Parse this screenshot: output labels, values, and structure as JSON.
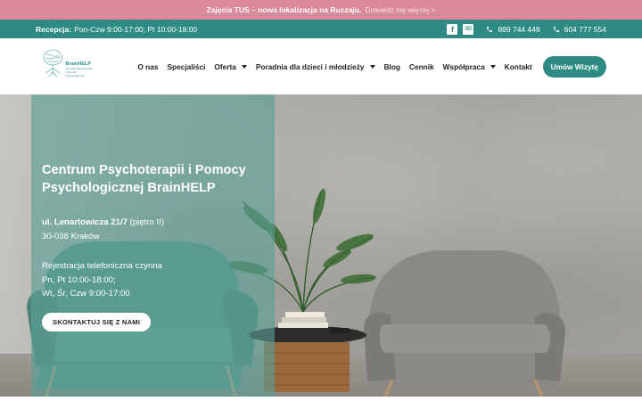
{
  "promo": {
    "text": "Zajęcia TUS – nowa lokalizacja na Ruczaju.",
    "link": "Dowiedz się więcej >"
  },
  "infobar": {
    "reception_label": "Recepcja:",
    "reception_hours": "Pon-Czw 9:00-17:00; Pt 10:00-18:00",
    "social": [
      {
        "icon": "facebook-icon",
        "glyph": "f"
      },
      {
        "icon": "email-icon",
        "glyph": "✉"
      }
    ],
    "phones": [
      "889 744 448",
      "604 777 554"
    ]
  },
  "header": {
    "logo": {
      "name": "BrainHELP",
      "subtitle_1": "Centrum Psychoterapii",
      "subtitle_2": "i Pomocy Psychologicznej"
    },
    "nav": [
      {
        "label": "O nas",
        "dropdown": false
      },
      {
        "label": "Specjaliści",
        "dropdown": false
      },
      {
        "label": "Oferta",
        "dropdown": true
      },
      {
        "label": "Poradnia dla dzieci i młodzieży",
        "dropdown": true
      },
      {
        "label": "Blog",
        "dropdown": false
      },
      {
        "label": "Cennik",
        "dropdown": false
      },
      {
        "label": "Współpraca",
        "dropdown": true
      },
      {
        "label": "Kontakt",
        "dropdown": false
      }
    ],
    "cta": "Umów Wizytę"
  },
  "hero": {
    "title_line1": "Centrum Psychoterapii i Pomocy",
    "title_line2": "Psychologicznej BrainHELP",
    "address_street": "ul. Lenartowicza 21/7",
    "address_floor": "(piętro II)",
    "address_city": "30-038 Kraków",
    "reg_line1": "Rejestracja telefoniczna czynna",
    "reg_line2": "Pn, Pt 10:00-18:00;",
    "reg_line3": "Wt, Śr, Czw 9:00-17:00",
    "button": "SKONTAKTUJ SIĘ Z NAMI"
  },
  "colors": {
    "accent": "#2e8b84",
    "promo": "#d9899a",
    "overlay": "#58a096"
  }
}
